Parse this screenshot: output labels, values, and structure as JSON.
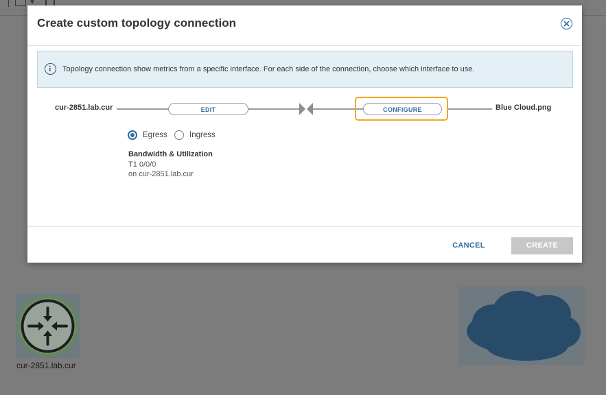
{
  "dialog": {
    "title": "Create custom topology connection",
    "info_text": "Topology connection show metrics from a specific interface. For each side of the connection, choose which interface to use."
  },
  "connection": {
    "left_node": "cur-2851.lab.cur",
    "right_node": "Blue Cloud.png",
    "edit_label": "EDIT",
    "configure_label": "CONFIGURE"
  },
  "direction": {
    "egress_label": "Egress",
    "ingress_label": "Ingress",
    "selected": "Egress"
  },
  "interface": {
    "metric_title": "Bandwidth & Utilization",
    "name": "T1 0/0/0",
    "node_text": "on cur-2851.lab.cur"
  },
  "footer": {
    "cancel_label": "CANCEL",
    "create_label": "CREATE"
  },
  "background": {
    "router_label": "cur-2851.lab.cur"
  },
  "colors": {
    "accent": "#2f6c9c",
    "highlight": "#f0a820",
    "info_bg": "#e5f0f6",
    "disabled": "#c7c7c7"
  },
  "icons": [
    "close-icon",
    "info-icon",
    "bowtie-icon",
    "router-icon",
    "cloud-icon"
  ]
}
